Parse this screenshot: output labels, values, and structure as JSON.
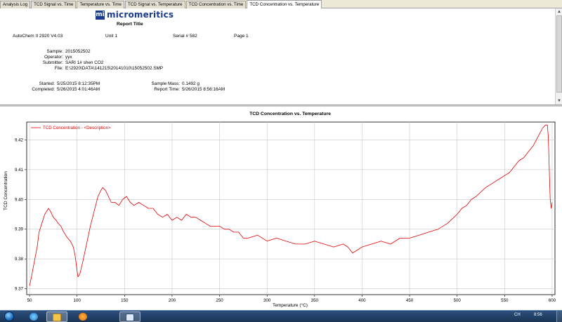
{
  "tabs": [
    {
      "label": "Analysis Log",
      "active": false
    },
    {
      "label": "TCD Signal vs. Time",
      "active": false
    },
    {
      "label": "Temperature vs. Time",
      "active": false
    },
    {
      "label": "TCD Signal vs. Temperature",
      "active": false
    },
    {
      "label": "TCD Concentration vs. Time",
      "active": false
    },
    {
      "label": "TCD Concentration vs. Temperature",
      "active": true
    }
  ],
  "report": {
    "logo_mark": "mi",
    "logo_name": "micromeritics",
    "title": "Report Title",
    "instrument": "AutoChem II 2920 V4.03",
    "unit": "Unit 1",
    "serial": "Serial # 582",
    "page": "Page 1",
    "sample_label": "Sample:",
    "sample": "2015052502",
    "operator_label": "Operator:",
    "operator": "yyx",
    "submitter_label": "Submitter:",
    "submitter": "SARI 1# shen CO2",
    "file_label": "File:",
    "file": "E:\\2920\\DATA\\141215\\20141010\\15052502.SMP",
    "started_label": "Started:",
    "started": "5/25/2015 8:12:35PM",
    "completed_label": "Completed:",
    "completed": "5/26/2015 4:01:46AM",
    "mass_label": "Sample Mass:",
    "mass": "0.1492 g",
    "report_time_label": "Report Time:",
    "report_time": "5/26/2015 8:56:16AM"
  },
  "chart_data": {
    "type": "line",
    "title": "TCD Concentration vs. Temperature",
    "xlabel": "Temperature (°C)",
    "ylabel": "TCD Concentration",
    "xlim": [
      47,
      603
    ],
    "ylim": [
      9.368,
      9.426
    ],
    "xticks": [
      50,
      100,
      150,
      200,
      250,
      300,
      350,
      400,
      450,
      500,
      550,
      600
    ],
    "yticks": [
      9.37,
      9.38,
      9.39,
      9.4,
      9.41,
      9.42
    ],
    "ytick_labels": [
      "9.37",
      "9.38",
      "9.39",
      "9.40",
      "9.41",
      "9.42"
    ],
    "grid": true,
    "legend": "top-left",
    "series": [
      {
        "name": "TCD Concentration - <Description>",
        "color": "#e00000",
        "x": [
          50,
          52,
          55,
          58,
          60,
          63,
          66,
          68,
          70,
          72,
          75,
          78,
          80,
          83,
          86,
          88,
          90,
          93,
          96,
          98,
          100,
          101,
          103,
          106,
          110,
          114,
          118,
          122,
          125,
          127,
          130,
          133,
          136,
          140,
          144,
          148,
          152,
          156,
          160,
          165,
          170,
          175,
          180,
          185,
          190,
          195,
          200,
          205,
          210,
          215,
          220,
          225,
          230,
          235,
          240,
          245,
          250,
          255,
          260,
          265,
          270,
          275,
          280,
          290,
          300,
          310,
          320,
          330,
          340,
          350,
          360,
          370,
          380,
          385,
          390,
          395,
          400,
          410,
          420,
          430,
          440,
          450,
          460,
          470,
          480,
          490,
          500,
          505,
          510,
          515,
          520,
          530,
          540,
          545,
          550,
          555,
          560,
          565,
          570,
          575,
          580,
          585,
          590,
          593,
          595,
          596,
          597,
          598,
          599,
          600
        ],
        "y": [
          9.371,
          9.374,
          9.379,
          9.384,
          9.389,
          9.392,
          9.395,
          9.396,
          9.397,
          9.396,
          9.394,
          9.393,
          9.392,
          9.391,
          9.389,
          9.388,
          9.387,
          9.386,
          9.384,
          9.381,
          9.376,
          9.374,
          9.375,
          9.379,
          9.385,
          9.391,
          9.396,
          9.401,
          9.403,
          9.404,
          9.403,
          9.401,
          9.399,
          9.399,
          9.398,
          9.4,
          9.401,
          9.399,
          9.398,
          9.399,
          9.398,
          9.397,
          9.397,
          9.395,
          9.394,
          9.395,
          9.393,
          9.394,
          9.393,
          9.395,
          9.394,
          9.394,
          9.393,
          9.392,
          9.391,
          9.391,
          9.391,
          9.39,
          9.39,
          9.389,
          9.389,
          9.387,
          9.387,
          9.388,
          9.386,
          9.387,
          9.386,
          9.385,
          9.385,
          9.386,
          9.385,
          9.384,
          9.385,
          9.384,
          9.382,
          9.383,
          9.384,
          9.385,
          9.386,
          9.385,
          9.387,
          9.387,
          9.388,
          9.389,
          9.39,
          9.392,
          9.395,
          9.397,
          9.398,
          9.4,
          9.401,
          9.404,
          9.406,
          9.407,
          9.408,
          9.409,
          9.411,
          9.413,
          9.414,
          9.416,
          9.418,
          9.421,
          9.424,
          9.425,
          9.425,
          9.421,
          9.41,
          9.4,
          9.397,
          9.399
        ]
      }
    ]
  },
  "taskbar": {
    "tray_lang": "CH",
    "tray_clock": "8:56"
  }
}
